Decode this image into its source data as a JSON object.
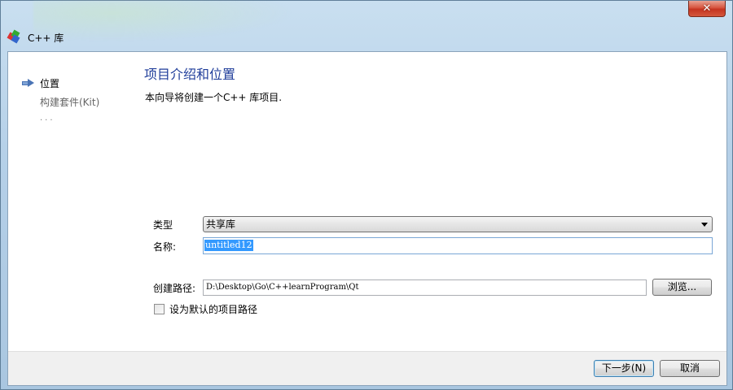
{
  "window": {
    "title": "C++ 库",
    "close_label": "✕"
  },
  "sidebar": {
    "steps": [
      {
        "label": "位置"
      },
      {
        "label": "构建套件(Kit)"
      },
      {
        "label": "..."
      }
    ]
  },
  "page": {
    "title": "项目介绍和位置",
    "description": "本向导将创建一个C++ 库项目."
  },
  "form": {
    "type_label": "类型",
    "type_value": "共享库",
    "name_label": "名称:",
    "name_value": "untitled12",
    "path_label": "创建路径:",
    "path_value": "D:\\Desktop\\Go\\C++learnProgram\\Qt",
    "browse_label": "浏览...",
    "default_path_label": "设为默认的项目路径",
    "default_path_checked": false
  },
  "footer": {
    "next_label": "下一步(N)",
    "cancel_label": "取消"
  }
}
